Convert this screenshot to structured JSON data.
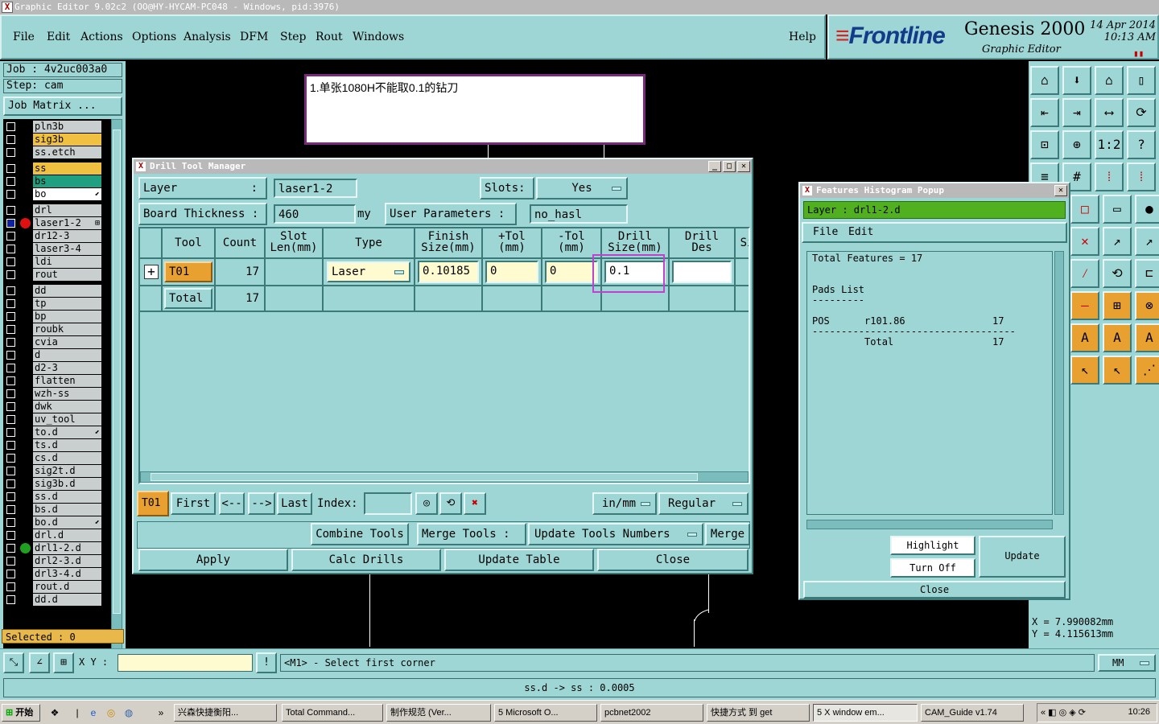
{
  "window_title": "Graphic Editor 9.02c2 (OO@HY-HYCAM-PC048 - Windows, pid:3976)",
  "menu": [
    "File",
    "Edit",
    "Actions",
    "Options",
    "Analysis",
    "DFM",
    "Step",
    "Rout",
    "Windows"
  ],
  "help": "Help",
  "logo": {
    "brand": "Frontline",
    "product": "Genesis 2000",
    "sub": "Graphic Editor",
    "date": "14 Apr 2014",
    "time": "10:13 AM"
  },
  "job": "Job : 4v2uc003a0",
  "step": "Step: cam",
  "job_matrix": "Job Matrix ...",
  "layers": [
    {
      "name": "pln3b",
      "color": "#c9cfcf"
    },
    {
      "name": "sig3b",
      "color": "#f0c040"
    },
    {
      "name": "ss.etch",
      "color": "#c9cfcf"
    },
    {
      "name": "ss",
      "color": "#f0c040"
    },
    {
      "name": "bs",
      "color": "#20a080"
    },
    {
      "name": "bo",
      "color": "#ffffff",
      "sym": "⬋"
    },
    {
      "name": "drl",
      "color": "#c9cfcf"
    },
    {
      "name": "laser1-2",
      "color": "#c9cfcf",
      "dot": "#e01010",
      "sym": "⊞",
      "sel": true
    },
    {
      "name": "dr12-3",
      "color": "#c9cfcf"
    },
    {
      "name": "laser3-4",
      "color": "#c9cfcf"
    },
    {
      "name": "ldi",
      "color": "#c9cfcf"
    },
    {
      "name": "rout",
      "color": "#c9cfcf"
    },
    {
      "name": "dd",
      "color": "#c9cfcf"
    },
    {
      "name": "tp",
      "color": "#c9cfcf"
    },
    {
      "name": "bp",
      "color": "#c9cfcf"
    },
    {
      "name": "roubk",
      "color": "#c9cfcf"
    },
    {
      "name": "cvia",
      "color": "#c9cfcf"
    },
    {
      "name": "d",
      "color": "#c9cfcf"
    },
    {
      "name": "d2-3",
      "color": "#c9cfcf"
    },
    {
      "name": "flatten",
      "color": "#c9cfcf"
    },
    {
      "name": "wzh-ss",
      "color": "#c9cfcf"
    },
    {
      "name": "dwk",
      "color": "#c9cfcf"
    },
    {
      "name": "uv_tool",
      "color": "#c9cfcf"
    },
    {
      "name": "to.d",
      "color": "#c9cfcf",
      "sym": "⬋"
    },
    {
      "name": "ts.d",
      "color": "#c9cfcf"
    },
    {
      "name": "cs.d",
      "color": "#c9cfcf"
    },
    {
      "name": "sig2t.d",
      "color": "#c9cfcf"
    },
    {
      "name": "sig3b.d",
      "color": "#c9cfcf"
    },
    {
      "name": "ss.d",
      "color": "#c9cfcf"
    },
    {
      "name": "bs.d",
      "color": "#c9cfcf"
    },
    {
      "name": "bo.d",
      "color": "#c9cfcf",
      "sym": "⬋"
    },
    {
      "name": "drl.d",
      "color": "#c9cfcf"
    },
    {
      "name": "drl1-2.d",
      "color": "#c9cfcf",
      "dot": "#20a020"
    },
    {
      "name": "drl2-3.d",
      "color": "#c9cfcf"
    },
    {
      "name": "drl3-4.d",
      "color": "#c9cfcf"
    },
    {
      "name": "rout.d",
      "color": "#c9cfcf"
    },
    {
      "name": "dd.d",
      "color": "#c9cfcf"
    }
  ],
  "selected": "Selected : 0",
  "note": "1.单张1080H不能取0.1的钻刀",
  "coords": {
    "x": "X = 7.990082mm",
    "y": "Y = 4.115613mm"
  },
  "cmd": {
    "xy_label": "X Y :",
    "prompt": "<M1> - Select first corner",
    "units": "MM"
  },
  "status": "ss.d -> ss : 0.0005",
  "dtm": {
    "title": "Drill Tool Manager",
    "layer_label": "Layer",
    "layer_colon": ":",
    "layer_value": "laser1-2",
    "slots_label": "Slots:",
    "slots_value": "Yes",
    "board_label": "Board Thickness :",
    "board_value": "460",
    "board_unit": "my",
    "user_params_label": "User Parameters :",
    "user_params_value": "no_hasl",
    "headers": [
      "Tool",
      "Count",
      "Slot\nLen(mm)",
      "Type",
      "Finish\nSize(mm)",
      "+Tol\n(mm)",
      "-Tol\n(mm)",
      "Drill\nSize(mm)",
      "Drill\nDes",
      "Si"
    ],
    "row": {
      "expand": "+",
      "tool": "T01",
      "count": "17",
      "type": "Laser",
      "finish": "0.10185",
      "ptol": "0",
      "mtol": "0",
      "drill": "0.1",
      "des": ""
    },
    "total": {
      "label": "Total",
      "count": "17"
    },
    "nav": {
      "tool": "T01",
      "first": "First",
      "prev": "<--",
      "next": "-->",
      "last": "Last",
      "index": "Index:",
      "units": "in/mm",
      "mode": "Regular"
    },
    "actions": {
      "combine": "Combine Tools",
      "merge_label": "Merge Tools :",
      "update_numbers": "Update Tools Numbers",
      "merge": "Merge"
    },
    "bottom": {
      "apply": "Apply",
      "calc": "Calc Drills",
      "update": "Update Table",
      "close": "Close"
    }
  },
  "hist": {
    "title": "Features Histogram Popup",
    "layer": "Layer :  drl1-2.d",
    "menu": [
      "File",
      "Edit"
    ],
    "text": "Total Features = 17\n\n\nPads List\n---------\n\nPOS      r101.86               17\n-----------------------------------\n         Total                 17",
    "highlight": "Highlight",
    "turn_off": "Turn Off",
    "update": "Update",
    "close": "Close"
  },
  "taskbar": {
    "start": "开始",
    "tasks": [
      "兴森快捷衡阳...",
      "Total Command...",
      "制作规范 (Ver...",
      "5 Microsoft O...",
      "pcbnet2002",
      "快捷方式 到 get",
      "5 X window em...",
      "CAM_Guide v1.74"
    ],
    "clock": "10:26"
  }
}
